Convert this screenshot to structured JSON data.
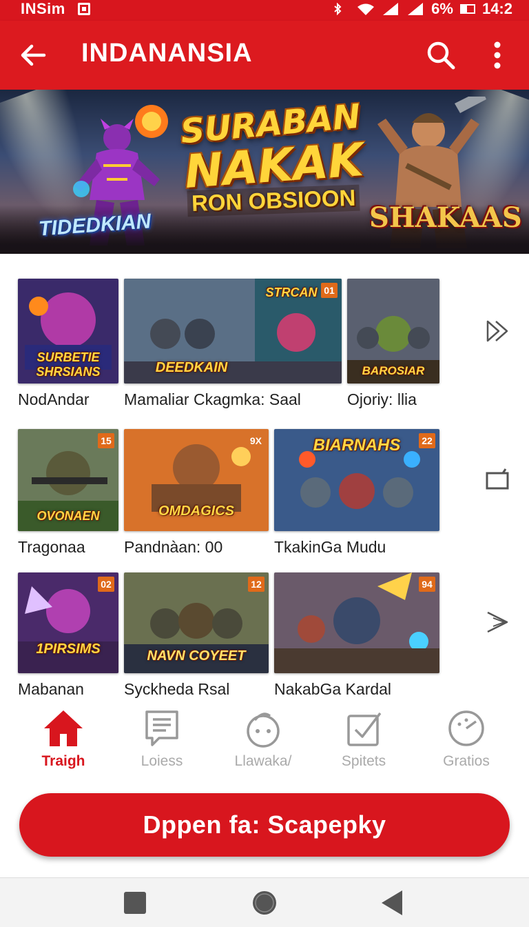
{
  "status_bar": {
    "carrier": "INSim",
    "battery_percent": "6%",
    "time": "14:2",
    "icons": [
      "sim-card-icon",
      "bluetooth-icon",
      "wifi-icon",
      "signal-icon",
      "signal-icon",
      "battery-icon"
    ]
  },
  "app_bar": {
    "title": "INDANANSIA",
    "back_icon": "arrow-left-icon",
    "search_icon": "search-icon",
    "menu_icon": "more-vert-icon"
  },
  "banner": {
    "title_line1": "SURABAN",
    "title_line2": "NAKAK",
    "subtitle": "RON OBSIOON",
    "left_logo": "TIDEDKIAN",
    "right_logo": "SHAKAAS"
  },
  "grid": {
    "rows": [
      {
        "tiles": [
          {
            "logo": "SURBETIE SHRSIANS",
            "badge": ""
          },
          {
            "logo": "DEEDKAIN",
            "badge": ""
          },
          {
            "logo": "STRCAN",
            "badge": "01"
          },
          {
            "logo": "BAROSIAR",
            "badge": ""
          }
        ],
        "captions": [
          "NodAndar",
          "Mamaliar Ckagmka: Saal",
          "Ojoriy: llia"
        ],
        "arrow_icon": "double-chevron-right-icon"
      },
      {
        "tiles": [
          {
            "logo": "OVONAEN",
            "badge": "15"
          },
          {
            "logo": "OMDAGICS",
            "badge": "9X"
          },
          {
            "logo": "BIARNAHS",
            "badge": "22"
          }
        ],
        "captions": [
          "Tragonaa",
          "Pandnàan: 00",
          "TkakinGa Mudu"
        ],
        "arrow_icon": "expand-icon"
      },
      {
        "tiles": [
          {
            "logo": "1PIRSIMS",
            "badge": "02"
          },
          {
            "logo": "NAVN COYEET",
            "badge": "12"
          },
          {
            "logo": "",
            "badge": "94"
          }
        ],
        "captions": [
          "Mabanan",
          "Syckheda Rsal",
          "NakabGa Kardal"
        ],
        "arrow_icon": "chevron-right-icon"
      }
    ]
  },
  "bottom_nav": {
    "items": [
      {
        "label": "Traigh",
        "icon": "home-icon",
        "active": true
      },
      {
        "label": "Loiess",
        "icon": "chat-list-icon",
        "active": false
      },
      {
        "label": "Llawaka/",
        "icon": "face-icon",
        "active": false
      },
      {
        "label": "Spitets",
        "icon": "checkbox-icon",
        "active": false
      },
      {
        "label": "Gratios",
        "icon": "gauge-icon",
        "active": false
      }
    ]
  },
  "cta": {
    "label": "Dppen fa: Scapepky"
  },
  "colors": {
    "primary": "#d8161e",
    "inactive": "#aaaaaa",
    "badge": "#e06a1a"
  }
}
